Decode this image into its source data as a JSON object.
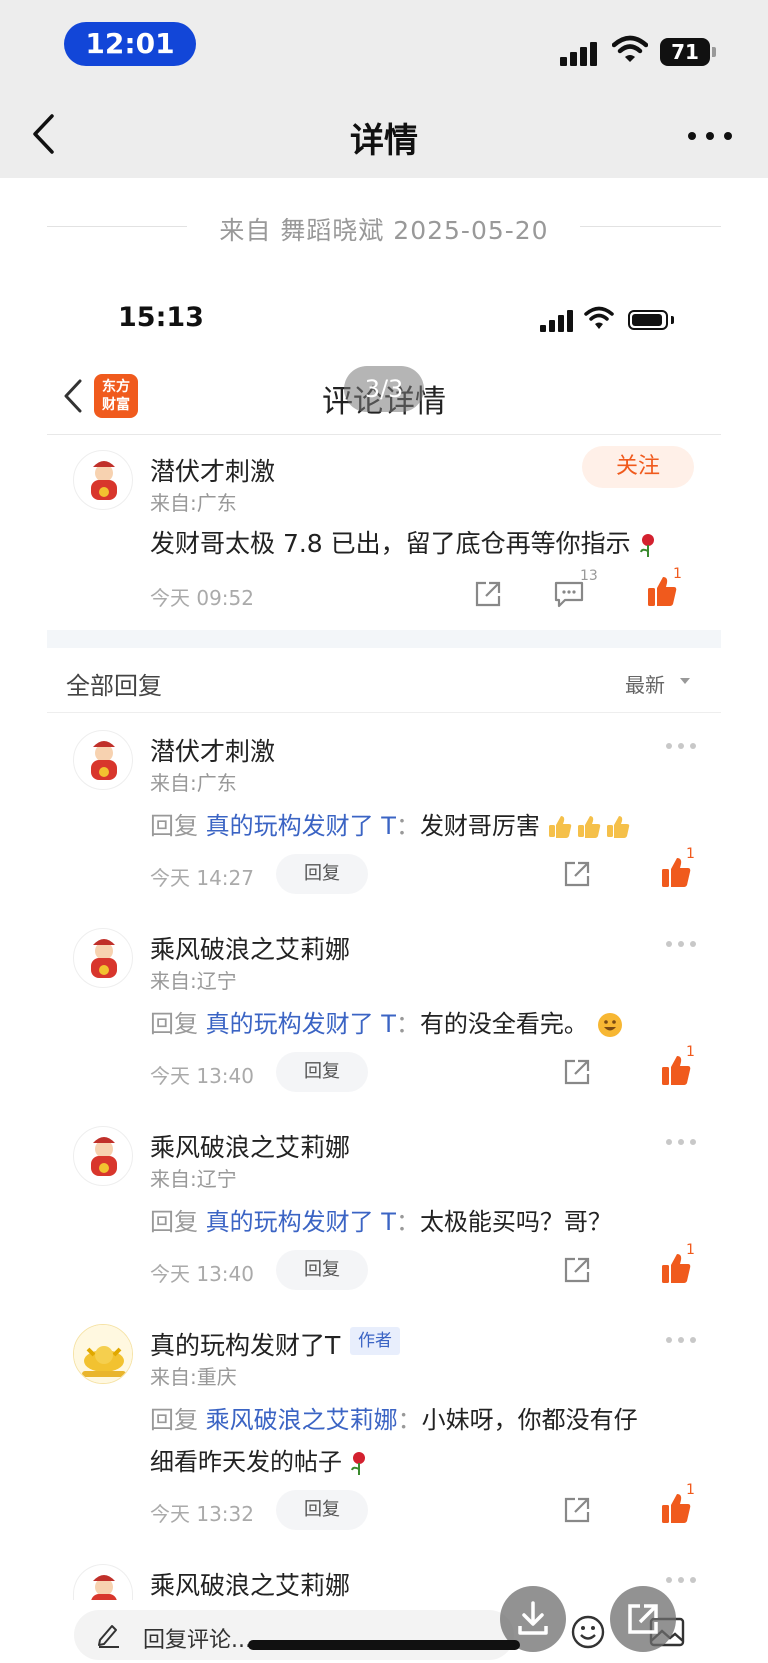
{
  "status_bar": {
    "time": "12:01",
    "battery": "71"
  },
  "nav": {
    "title": "详情"
  },
  "source": {
    "text": "来自 舞蹈晓斌 2025-05-20"
  },
  "inner": {
    "status_time": "15:13",
    "logo_line1": "东方",
    "logo_line2": "财富",
    "title": "评论详情",
    "page_indicator": "3/3"
  },
  "main_post": {
    "user": "潜伏才刺激",
    "location": "来自:广东",
    "follow_label": "关注",
    "text": "发财哥太极 7.8 已出，留了底仓再等你指示",
    "time": "今天 09:52",
    "comment_count": "13",
    "like_count": "1"
  },
  "replies_header": {
    "label": "全部回复",
    "sort": "最新"
  },
  "replies": [
    {
      "user": "潜伏才刺激",
      "location": "来自:广东",
      "prefix": "回复",
      "reply_to": "真的玩构发财了 T",
      "sep": "：",
      "text": "发财哥厉害",
      "time": "今天 14:27",
      "reply_btn": "回复",
      "likes": "1"
    },
    {
      "user": "乘风破浪之艾莉娜",
      "location": "来自:辽宁",
      "prefix": "回复",
      "reply_to": "真的玩构发财了 T",
      "sep": "：",
      "text": "有的没全看完。",
      "time": "今天 13:40",
      "reply_btn": "回复",
      "likes": "1"
    },
    {
      "user": "乘风破浪之艾莉娜",
      "location": "来自:辽宁",
      "prefix": "回复",
      "reply_to": "真的玩构发财了 T",
      "sep": "：",
      "text": "太极能买吗？哥？",
      "time": "今天 13:40",
      "reply_btn": "回复",
      "likes": "1"
    },
    {
      "user": "真的玩构发财了T",
      "author_tag": "作者",
      "location": "来自:重庆",
      "prefix": "回复",
      "reply_to": "乘风破浪之艾莉娜",
      "sep": "：",
      "text": "小妹呀，你都没有仔",
      "text2": "细看昨天发的帖子",
      "time": "今天 13:32",
      "reply_btn": "回复",
      "likes": "1"
    },
    {
      "user": "乘风破浪之艾莉娜"
    }
  ],
  "bottom": {
    "placeholder": "回复评论..."
  },
  "colors": {
    "accent": "#f05a1d",
    "link": "#3b64c4",
    "pill": "#1246d8"
  }
}
